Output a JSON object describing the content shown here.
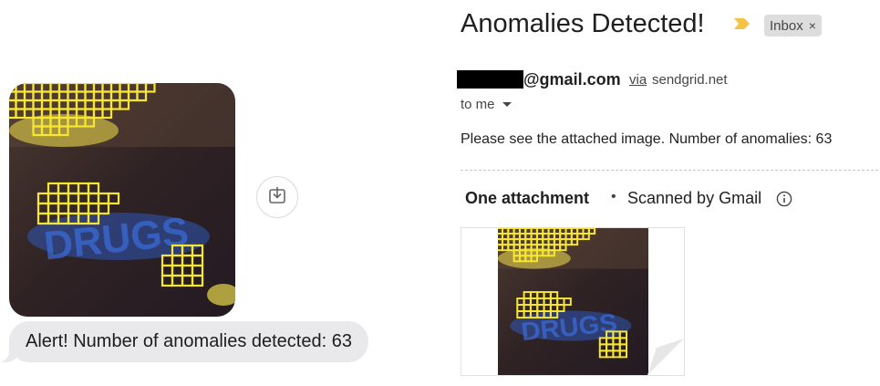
{
  "messages": {
    "alert_text": "Alert! Number of anomalies detected: 63",
    "image_overlay_text": "DRUGS"
  },
  "email": {
    "subject": "Anomalies Detected!",
    "label": "Inbox",
    "label_close": "×",
    "sender_suffix": "@gmail.com",
    "via_label": "via",
    "via_domain": "sendgrid.net",
    "recipient": "to me",
    "body": "Please see the attached image. Number of anomalies: 63",
    "attachment_heading": "One attachment",
    "separator": "•",
    "scan_note": "Scanned by Gmail"
  },
  "icons": {
    "download": "download-icon",
    "important": "important-marker-icon",
    "info": "info-icon",
    "caret": "chevron-down-icon"
  },
  "colors": {
    "detection_box": "#f7e733",
    "important_marker": "#f4c244",
    "bubble_bg": "#e9e9eb"
  }
}
